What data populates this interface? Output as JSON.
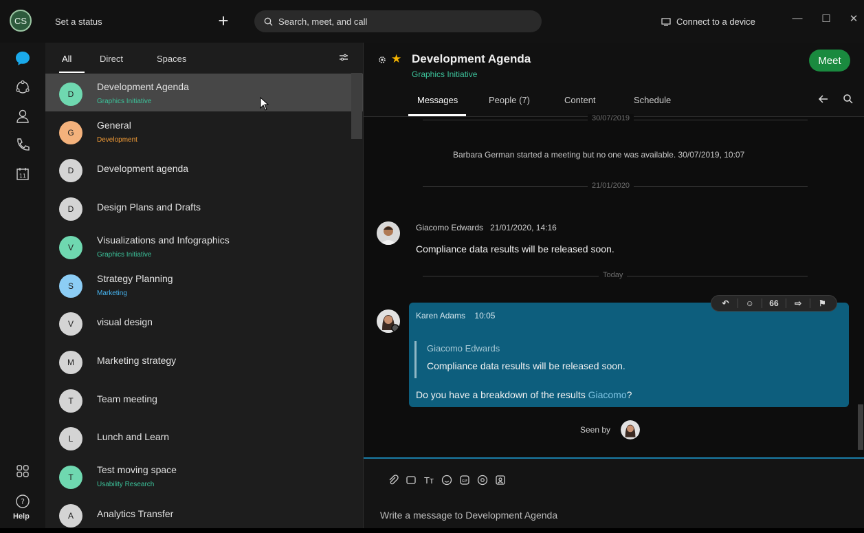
{
  "topbar": {
    "avatar_initials": "CS",
    "set_status": "Set a status",
    "search_placeholder": "Search, meet, and call",
    "connect_device": "Connect to a device"
  },
  "rail": {
    "calendar_day": "11",
    "help_label": "Help"
  },
  "filter_tabs": {
    "all": "All",
    "direct": "Direct",
    "spaces": "Spaces"
  },
  "spaces": [
    {
      "initial": "D",
      "title": "Development Agenda",
      "team": "Graphics Initiative",
      "team_color": "#3cc29a",
      "avatar_color": "#6fd8b0",
      "selected": true
    },
    {
      "initial": "G",
      "title": "General",
      "team": "Development",
      "team_color": "#f39c36",
      "avatar_color": "#f4b27c"
    },
    {
      "initial": "D",
      "title": "Development agenda",
      "team": "",
      "avatar_color": "#d4d4d4"
    },
    {
      "initial": "D",
      "title": "Design Plans and Drafts",
      "team": "",
      "avatar_color": "#d4d4d4"
    },
    {
      "initial": "V",
      "title": "Visualizations and Infographics",
      "team": "Graphics Initiative",
      "team_color": "#3cc29a",
      "avatar_color": "#6fd8b0"
    },
    {
      "initial": "S",
      "title": "Strategy Planning",
      "team": "Marketing",
      "team_color": "#46b4f0",
      "avatar_color": "#8ccdf5"
    },
    {
      "initial": "V",
      "title": "visual design",
      "team": "",
      "avatar_color": "#d4d4d4"
    },
    {
      "initial": "M",
      "title": "Marketing strategy",
      "team": "",
      "avatar_color": "#d4d4d4"
    },
    {
      "initial": "T",
      "title": "Team meeting",
      "team": "",
      "avatar_color": "#d4d4d4"
    },
    {
      "initial": "L",
      "title": "Lunch and Learn",
      "team": "",
      "avatar_color": "#d4d4d4"
    },
    {
      "initial": "T",
      "title": "Test moving space",
      "team": "Usability Research",
      "team_color": "#3cc29a",
      "avatar_color": "#6fd8b0"
    },
    {
      "initial": "A",
      "title": "Analytics Transfer",
      "team": "",
      "avatar_color": "#d4d4d4"
    }
  ],
  "conversation": {
    "title": "Development Agenda",
    "team": "Graphics Initiative",
    "meet_label": "Meet",
    "tabs": {
      "messages": "Messages",
      "people": "People (7)",
      "content": "Content",
      "schedule": "Schedule"
    },
    "top_date": "30/07/2019",
    "system_message": "Barbara German started a meeting but no one was available. 30/07/2019, 10:07",
    "date_divider": "21/01/2020",
    "message1": {
      "author": "Giacomo Edwards",
      "time": "21/01/2020, 14:16",
      "text": "Compliance data results will be released soon."
    },
    "today_divider": "Today",
    "message2": {
      "author": "Karen Adams",
      "time": "10:05",
      "quote_author": "Giacomo Edwards",
      "quote_text": "Compliance data results will be released soon.",
      "text_before_mention": "Do you have a breakdown of the results ",
      "mention": "Giacomo",
      "text_after_mention": "?"
    },
    "message_toolbar": {
      "quote_glyph": "66"
    },
    "seen_by": "Seen by",
    "composer_placeholder": "Write a message to Development Agenda"
  }
}
